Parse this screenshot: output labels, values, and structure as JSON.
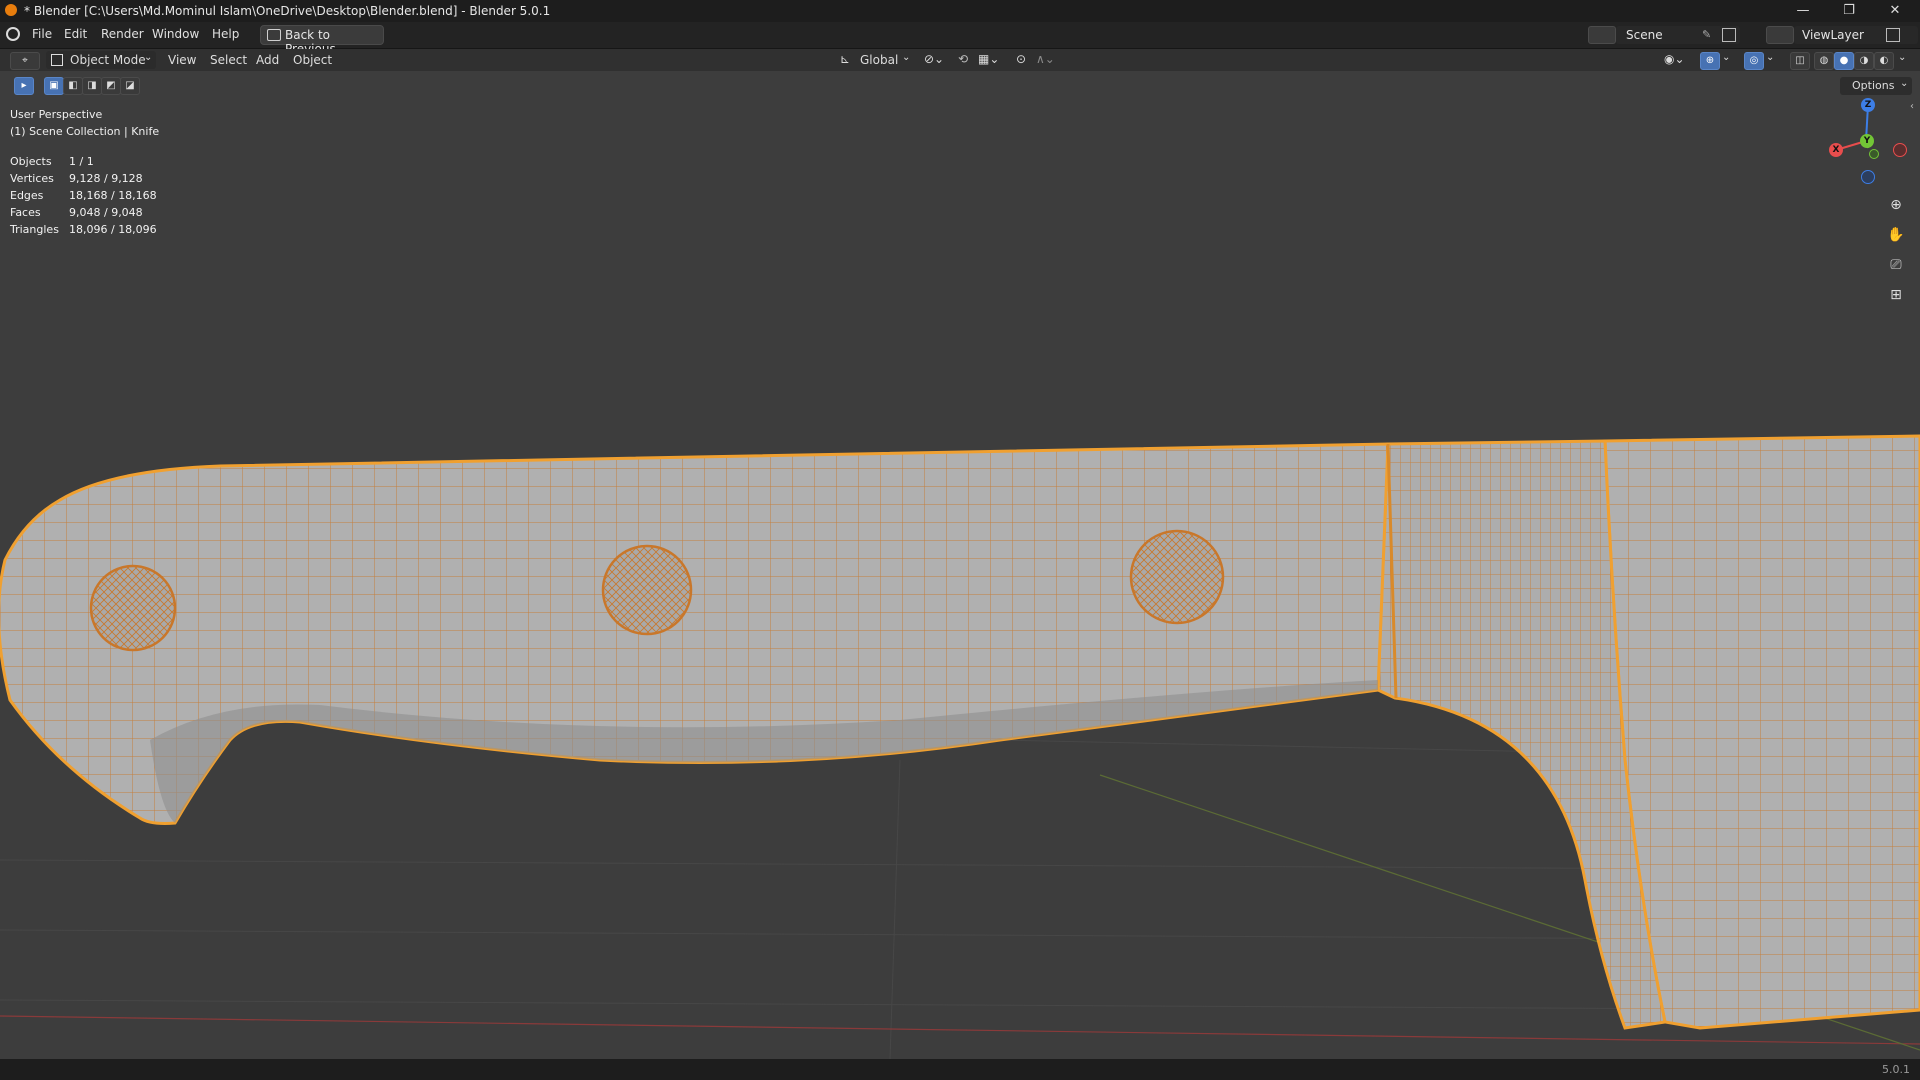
{
  "window": {
    "title": "* Blender [C:\\Users\\Md.Mominul Islam\\OneDrive\\Desktop\\Blender.blend] - Blender 5.0.1",
    "minimize_glyph": "—",
    "maximize_glyph": "❐",
    "close_glyph": "✕"
  },
  "menubar": {
    "items": [
      "File",
      "Edit",
      "Render",
      "Window",
      "Help"
    ],
    "back_button": "Back to Previous",
    "scene_label": "Scene",
    "viewlayer_label": "ViewLayer"
  },
  "viewport_header": {
    "mode": "Object Mode",
    "menus": [
      "View",
      "Select",
      "Add",
      "Object"
    ],
    "orientation": "Global",
    "options_label": "Options"
  },
  "overlay": {
    "perspective": "User Perspective",
    "collection": "(1) Scene Collection | Knife",
    "stats": [
      {
        "label": "Objects",
        "value": "1 / 1"
      },
      {
        "label": "Vertices",
        "value": "9,128 / 9,128"
      },
      {
        "label": "Edges",
        "value": "18,168 / 18,168"
      },
      {
        "label": "Faces",
        "value": "9,048 / 9,048"
      },
      {
        "label": "Triangles",
        "value": "18,096 / 18,096"
      }
    ]
  },
  "gizmo": {
    "x_label": "X",
    "y_label": "Y",
    "z_label": "Z",
    "x_color": "#e84d4d",
    "y_color": "#73c636",
    "z_color": "#3d7ee6"
  },
  "statusbar": {
    "version": "5.0.1"
  },
  "colors": {
    "selection": "#f0a030",
    "mesh": "#aeaeae",
    "viewport_bg": "#3d3d3d"
  }
}
